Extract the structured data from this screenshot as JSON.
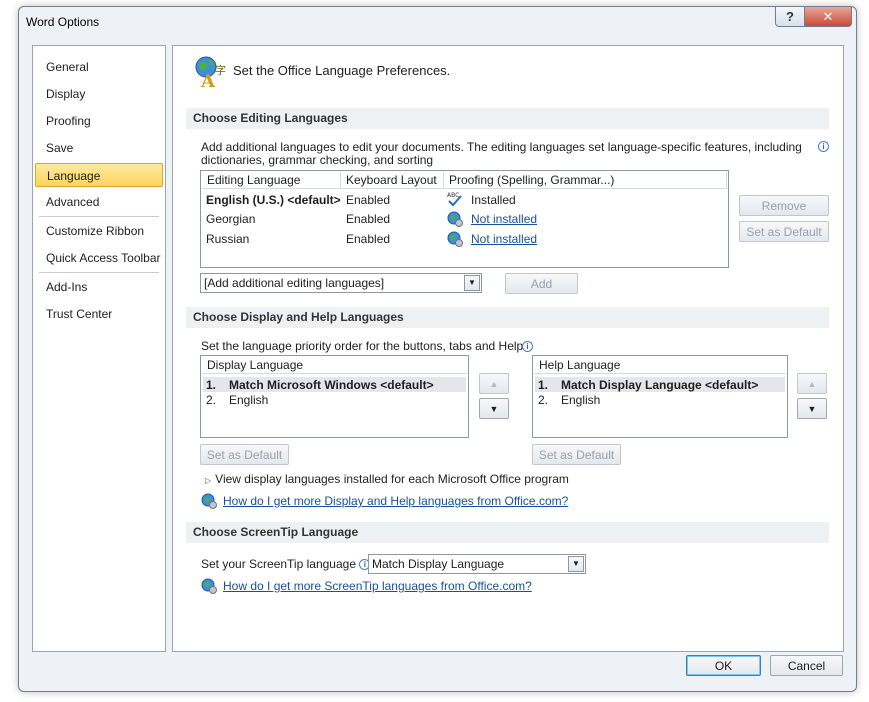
{
  "window": {
    "title": "Word Options",
    "help_glyph": "?",
    "close_glyph": "✕"
  },
  "nav": {
    "items": [
      {
        "label": "General"
      },
      {
        "label": "Display"
      },
      {
        "label": "Proofing"
      },
      {
        "label": "Save"
      },
      {
        "label": "Language",
        "active": true
      },
      {
        "label": "Advanced"
      },
      {
        "label": "Customize Ribbon"
      },
      {
        "label": "Quick Access Toolbar"
      },
      {
        "label": "Add-Ins"
      },
      {
        "label": "Trust Center"
      }
    ]
  },
  "page": {
    "title": "Set the Office Language Preferences."
  },
  "editing": {
    "header": "Choose Editing Languages",
    "description_line1": "Add additional languages to edit your documents. The editing languages set language-specific features, including",
    "description_line2": "dictionaries, grammar checking, and sorting",
    "columns": [
      "Editing Language",
      "Keyboard Layout",
      "Proofing (Spelling, Grammar...)"
    ],
    "rows": [
      {
        "language": "English (U.S.) <default>",
        "keyboard": "Enabled",
        "proofing": "Installed",
        "installed": true
      },
      {
        "language": "Georgian",
        "keyboard": "Enabled",
        "proofing": "Not installed",
        "installed": false
      },
      {
        "language": "Russian",
        "keyboard": "Enabled",
        "proofing": "Not installed",
        "installed": false
      }
    ],
    "remove_label": "Remove",
    "set_default_label": "Set as Default",
    "add_combo_value": "[Add additional editing languages]",
    "add_label": "Add"
  },
  "display_help": {
    "header": "Choose Display and Help Languages",
    "description": "Set the language priority order for the buttons, tabs and Help",
    "display_header": "Display Language",
    "display_items": [
      {
        "num": "1.",
        "label": "Match Microsoft Windows <default>"
      },
      {
        "num": "2.",
        "label": "English"
      }
    ],
    "help_header": "Help Language",
    "help_items": [
      {
        "num": "1.",
        "label": "Match Display Language <default>"
      },
      {
        "num": "2.",
        "label": "English"
      }
    ],
    "set_default_label": "Set as Default",
    "view_installed_label": "View display languages installed for each Microsoft Office program",
    "more_link": "How do I get more Display and Help languages from Office.com?"
  },
  "screentip": {
    "header": "Choose ScreenTip Language",
    "label": "Set your ScreenTip language",
    "combo_value": "Match Display Language",
    "more_link": "How do I get more ScreenTip languages from Office.com?"
  },
  "footer": {
    "ok_label": "OK",
    "cancel_label": "Cancel"
  },
  "colors": {
    "accent": "#fbd55b",
    "link": "#1a4fa0"
  }
}
